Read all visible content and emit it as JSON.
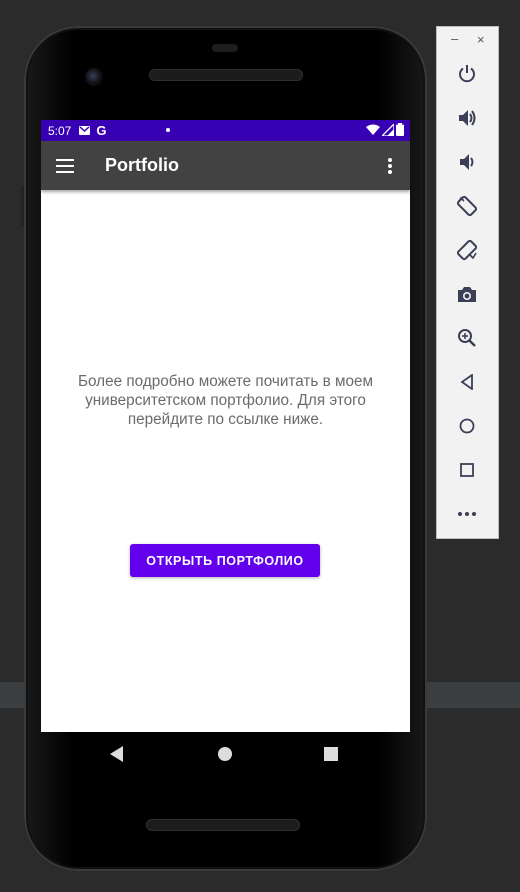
{
  "status_bar": {
    "time": "5:07",
    "icons": [
      "gmail-icon",
      "google-icon",
      "notification-dot-icon",
      "wifi-icon",
      "signal-icon",
      "battery-icon"
    ],
    "google_letter": "G",
    "color": "#3700b3"
  },
  "app_bar": {
    "title": "Portfolio",
    "color": "#424242"
  },
  "main": {
    "description": "Более подробно можете почитать в моем университетском портфолио. Для этого перейдите по ссылке ниже.",
    "button_label": "ОТКРЫТЬ ПОРТФОЛИО",
    "button_color": "#6200ee"
  },
  "navigation": {
    "icons": [
      "back-icon",
      "home-icon",
      "recents-icon"
    ]
  },
  "emulator_toolbar": {
    "minimize_label": "–",
    "close_label": "×",
    "icons": [
      "power-icon",
      "volume-up-icon",
      "volume-down-icon",
      "rotate-left-icon",
      "rotate-right-icon",
      "camera-icon",
      "zoom-icon",
      "back-icon",
      "home-icon",
      "overview-icon",
      "more-icon"
    ]
  }
}
